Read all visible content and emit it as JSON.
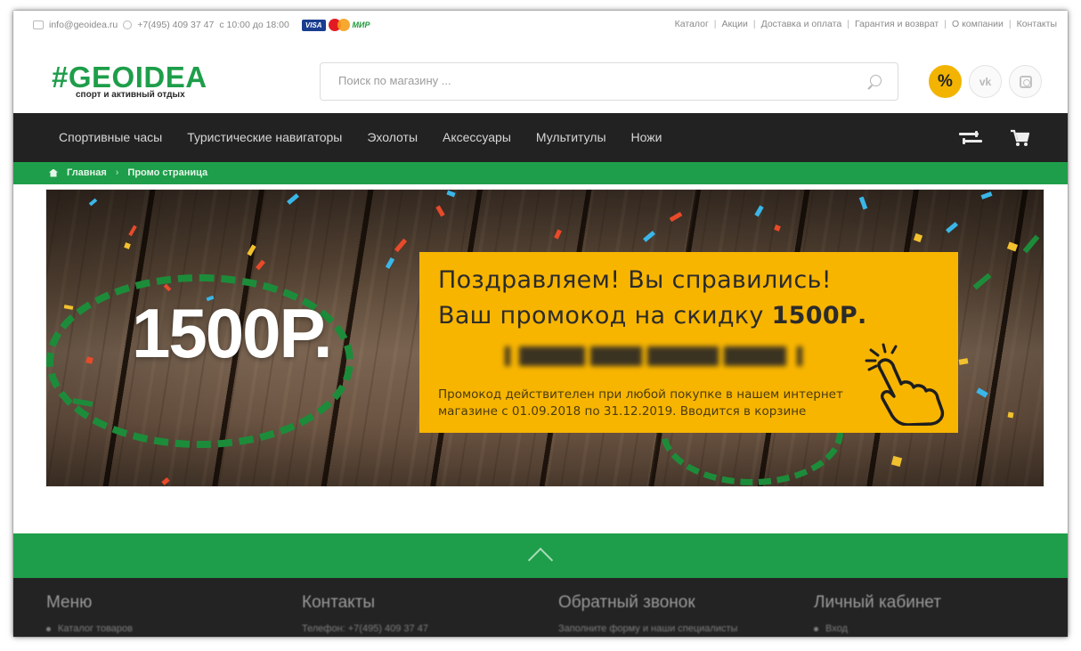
{
  "topbar": {
    "email": "info@geoidea.ru",
    "phone": "+7(495) 409 37 47",
    "hours": "с 10:00 до 18:00",
    "payments": [
      "VISA",
      "MasterCard",
      "МИР"
    ],
    "links": [
      "Каталог",
      "Акции",
      "Доставка и оплата",
      "Гарантия и возврат",
      "О компании",
      "Контакты"
    ]
  },
  "header": {
    "logo": "#GEOIDEA",
    "tagline": "спорт и активный отдых",
    "search_placeholder": "Поиск по магазину ...",
    "sale_badge": "%",
    "vk_label": "vk"
  },
  "nav": {
    "items": [
      "Спортивные часы",
      "Туристические навигаторы",
      "Эхолоты",
      "Аксессуары",
      "Мультитулы",
      "Ножи"
    ]
  },
  "breadcrumb": {
    "home": "Главная",
    "current": "Промо страница"
  },
  "banner": {
    "amount": "1500Р.",
    "line1": "Поздравляем! Вы справились!",
    "line2_prefix": "Ваш промокод на скидку ",
    "line2_amount": "1500Р.",
    "note_line1": "Промокод действителен при любой покупке в нашем интернет",
    "note_line2": "магазине с 01.09.2018 по 31.12.2019. Вводится в корзине",
    "colors": {
      "promo_bg": "#f8b500",
      "ring": "#1d8c3a"
    }
  },
  "footer": {
    "columns": [
      {
        "title": "Меню",
        "sub": "Каталог товаров"
      },
      {
        "title": "Контакты",
        "sub": "Телефон: +7(495) 409 37 47"
      },
      {
        "title": "Обратный звонок",
        "sub": "Заполните форму и наши специалисты"
      },
      {
        "title": "Личный кабинет",
        "sub": "Вход"
      }
    ]
  },
  "colors": {
    "brand_green": "#1e9e4a",
    "nav_bg": "#222222",
    "accent": "#f2b400"
  }
}
